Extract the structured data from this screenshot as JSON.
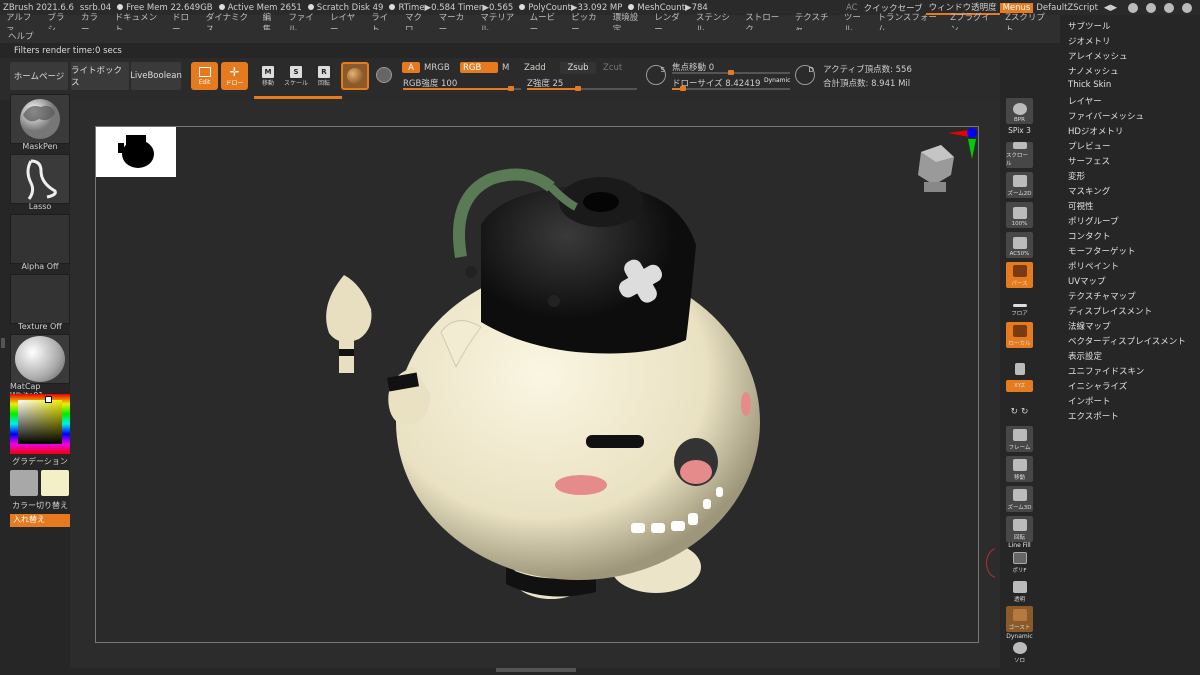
{
  "titlebar": {
    "app": "ZBrush 2021.6.6",
    "doc": "ssrb.04",
    "free_mem": "Free Mem 22.649GB",
    "active_mem": "Active Mem 2651",
    "scratch": "Scratch Disk 49",
    "rtime": "RTime▶0.584 Timer▶0.565",
    "polycount": "PolyCount▶33.092 MP",
    "meshcount": "MeshCount▶784",
    "ac": "AC",
    "quicksave": "クイックセーブ",
    "transparency": "ウィンドウ透明度",
    "menus": "Menus",
    "zscript": "DefaultZScript"
  },
  "menubar": [
    "アルファ",
    "ブラシ",
    "カラー",
    "ドキュメント",
    "ドロー",
    "ダイナミクス",
    "編集",
    "ファイル",
    "レイヤー",
    "ライト",
    "マクロ",
    "マーカー",
    "マテリアル",
    "ムービー",
    "ピッカー",
    "環境設定",
    "レンダー",
    "ステンシル",
    "ストローク",
    "テクスチャ",
    "ツール",
    "トランスフォーム",
    "Zプラグイン",
    "Zスクリプト"
  ],
  "menubar2": "ヘルプ",
  "status": "Filters render time:0 secs",
  "toolbar": {
    "home": "ホームページ",
    "lightbox": "ライトボックス",
    "liveboolean": "LiveBoolean",
    "edit": "Edit",
    "draw": "ドロー",
    "move": "移動",
    "scale": "スケール",
    "rotate": "回転",
    "a": "A",
    "mrgb": "MRGB",
    "rgb": "RGB",
    "m": "M",
    "rgb_intensity": "RGB強度 100",
    "zadd": "Zadd",
    "zsub": "Zsub",
    "zcut": "Zcut",
    "z_intensity": "Z強度 25",
    "focal_shift": "焦点移動 0",
    "draw_size": "ドローサイズ 8.42419",
    "dynamic": "Dynamic",
    "active_points": "アクティブ頂点数: 556",
    "total_points": "合計頂点数: 8.941 Mil"
  },
  "leftshelf": {
    "brush": "MaskPen",
    "stroke": "Lasso",
    "alpha": "Alpha Off",
    "texture": "Texture Off",
    "material": "MatCap White01",
    "gradient": "グラデーション",
    "switch": "カラー切り替え",
    "swap": "入れ替え"
  },
  "rightshelf": {
    "bpr": "BPR",
    "spix": "SPix 3",
    "scroll": "スクロール",
    "zoom2d": "ズーム2D",
    "p100": "100%",
    "ac50": "AC50%",
    "persp": "パース",
    "floor": "フロア",
    "local": "ローカル",
    "xyz": "XYZ",
    "frame": "フレーム",
    "move": "移動",
    "zoom3d": "ズーム3D",
    "rotate": "回転",
    "linefill": "Line Fill",
    "polyf": "ポリF",
    "transp": "透明",
    "ghost": "ゴースト",
    "solo_dyn": "Dynamic",
    "solo": "ソロ"
  },
  "rpanel": [
    "サブツール",
    "ジオメトリ",
    "アレイメッシュ",
    "ナノメッシュ",
    "Thick Skin",
    "レイヤー",
    "ファイバーメッシュ",
    "HDジオメトリ",
    "プレビュー",
    "サーフェス",
    "変形",
    "マスキング",
    "可視性",
    "ポリグループ",
    "コンタクト",
    "モーフターゲット",
    "ポリペイント",
    "UVマップ",
    "テクスチャマップ",
    "ディスプレイスメント",
    "法線マップ",
    "ベクターディスプレイスメント",
    "表示設定",
    "ユニファイドスキン",
    "イニシャライズ",
    "インポート",
    "エクスポート"
  ],
  "colors": {
    "accent": "#e57a1f",
    "bg": "#262626",
    "model": "#f0ead0"
  }
}
